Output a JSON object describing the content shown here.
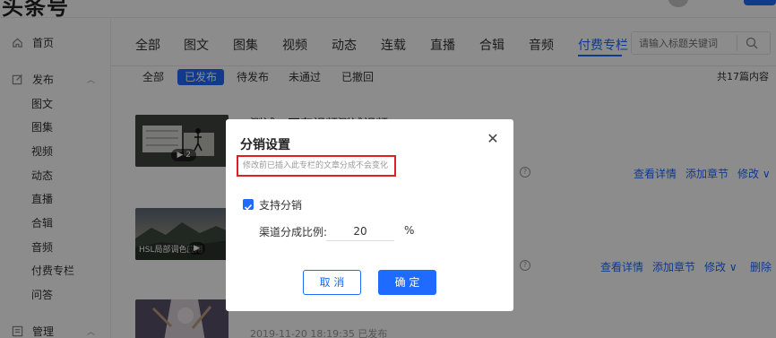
{
  "app": {
    "logo_text": "头条号"
  },
  "sidebar": {
    "home": {
      "label": "首页",
      "icon": "home-icon"
    },
    "publish": {
      "label": "发布",
      "icon": "edit-icon"
    },
    "publish_items": [
      "图文",
      "图集",
      "视频",
      "动态",
      "直播",
      "合辑",
      "音频",
      "付费专栏",
      "问答"
    ],
    "manage": {
      "label": "管理",
      "icon": "list-icon"
    }
  },
  "tabs": [
    "全部",
    "图文",
    "图集",
    "视频",
    "动态",
    "连载",
    "直播",
    "合辑",
    "音频",
    "付费专栏"
  ],
  "active_tab": "付费专栏",
  "search": {
    "placeholder": "请输入标题关键词"
  },
  "subtabs": [
    "全部",
    "已发布",
    "待发布",
    "未通过",
    "已撤回"
  ],
  "active_subtab": "已发布",
  "count_text": "共17篇内容",
  "rows": [
    {
      "title": "测试—不存视频测试视频",
      "badge": "2",
      "thumb_caption": "",
      "actions": [
        "查看详情",
        "添加章节",
        "修改 ∨"
      ]
    },
    {
      "title": "",
      "thumb_caption": "HSL局部调色应用",
      "actions": [
        "查看详情",
        "添加章节",
        "修改 ∨",
        "删除"
      ]
    },
    {
      "title": "",
      "meta": "2019-11-20 18:19:35   已发布",
      "actions": []
    }
  ],
  "modal": {
    "title": "分销设置",
    "hint": "修改前已插入此专栏的文章分成不会变化",
    "checkbox_label": "支持分销",
    "checked": true,
    "ratio_label": "渠道分成比例:",
    "ratio_value": "20",
    "ratio_unit": "%",
    "cancel_label": "取 消",
    "ok_label": "确 定"
  },
  "colors": {
    "accent": "#1f6aff",
    "hint_border": "#e02020",
    "overlay": "rgba(0,0,0,0.45)"
  }
}
